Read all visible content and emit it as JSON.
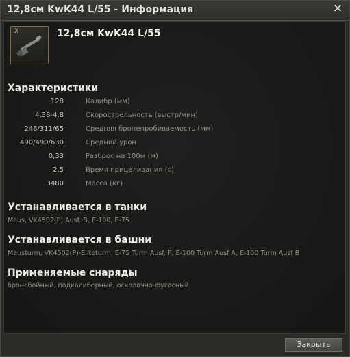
{
  "window": {
    "title": "12,8см KwK44 L/55 - Информация"
  },
  "item": {
    "tier": "X",
    "name": "12,8см KwK44 L/55",
    "icon": "gun-icon"
  },
  "characteristics": {
    "title": "Характеристики",
    "rows": [
      {
        "value": "128",
        "label": "Калибр (мм)"
      },
      {
        "value": "4,38-4,8",
        "label": "Скорострельность (выстр/мин)"
      },
      {
        "value": "246/311/65",
        "label": "Средняя бронепробиваемость (мм)"
      },
      {
        "value": "490/490/630",
        "label": "Средний урон"
      },
      {
        "value": "0,33",
        "label": "Разброс на 100м (м)"
      },
      {
        "value": "2,5",
        "label": "Время прицеливания (с)"
      },
      {
        "value": "3480",
        "label": "Масса (кг)"
      }
    ]
  },
  "tanks": {
    "title": "Устанавливается в танки",
    "text": "Maus, VK4502(P) Ausf. B, E-100, E-75"
  },
  "turrets": {
    "title": "Устанавливается в башни",
    "text": "Mausturm, VK4502(P)-Eliteturm, E-75 Turm Ausf. F, E-100 Turm Ausf A, E-100 Turm Ausf B"
  },
  "shells": {
    "title": "Применяемые снаряды",
    "text": "бронебойный, подкалиберный, осколочно-фугасный"
  },
  "footer": {
    "close_label": "Закрыть"
  }
}
